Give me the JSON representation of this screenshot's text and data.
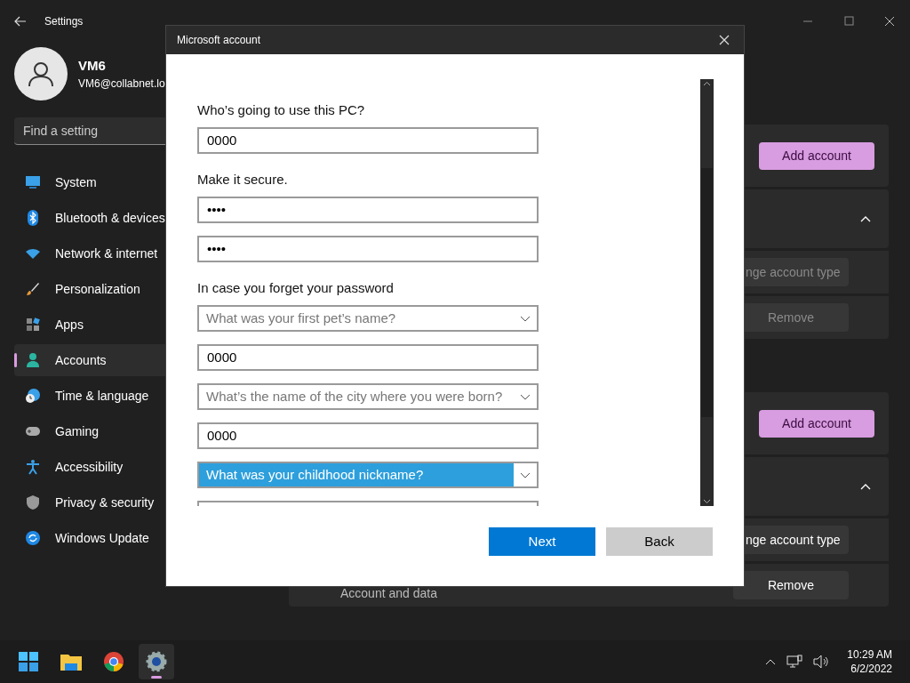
{
  "window": {
    "title": "Settings"
  },
  "profile": {
    "name": "VM6",
    "email": "VM6@collabnet.lo"
  },
  "search": {
    "placeholder": "Find a setting"
  },
  "nav": [
    {
      "label": "System",
      "selected": false
    },
    {
      "label": "Bluetooth & devices",
      "selected": false
    },
    {
      "label": "Network & internet",
      "selected": false
    },
    {
      "label": "Personalization",
      "selected": false
    },
    {
      "label": "Apps",
      "selected": false
    },
    {
      "label": "Accounts",
      "selected": true
    },
    {
      "label": "Time & language",
      "selected": false
    },
    {
      "label": "Gaming",
      "selected": false
    },
    {
      "label": "Accessibility",
      "selected": false
    },
    {
      "label": "Privacy & security",
      "selected": false
    },
    {
      "label": "Windows Update",
      "selected": false
    }
  ],
  "groups": [
    {
      "add_button": "Add account",
      "expanded": true,
      "change_button": {
        "label": "nge account type",
        "disabled": true
      },
      "remove_button": {
        "label": "Remove",
        "disabled": true
      }
    },
    {
      "add_button": "Add account",
      "expanded": true,
      "change_button": {
        "label": "nge account type",
        "disabled": false
      },
      "remove_button": {
        "label": "Remove",
        "disabled": false
      },
      "row_label": "Account and data"
    }
  ],
  "dialog": {
    "title": "Microsoft account",
    "fields": [
      {
        "kind": "label",
        "text": "Who’s going to use this PC?"
      },
      {
        "kind": "text",
        "value": "0000"
      },
      {
        "kind": "label",
        "text": "Make it secure."
      },
      {
        "kind": "text",
        "value": "••••"
      },
      {
        "kind": "text",
        "value": "••••"
      },
      {
        "kind": "label",
        "text": "In case you forget your password"
      },
      {
        "kind": "select",
        "placeholder": "What was your first pet’s name?",
        "highlighted": false
      },
      {
        "kind": "text",
        "value": "0000"
      },
      {
        "kind": "select",
        "placeholder": "What’s the name of the city where you were born?",
        "highlighted": false
      },
      {
        "kind": "text",
        "value": "0000"
      },
      {
        "kind": "select",
        "value": "What was your childhood nickname?",
        "highlighted": true
      },
      {
        "kind": "text"
      }
    ],
    "buttons": [
      {
        "label": "Next",
        "kind": "primary"
      },
      {
        "label": "Back",
        "kind": "secondary"
      }
    ]
  },
  "taskbar": {
    "time": "10:29 AM",
    "date": "6/2/2022"
  }
}
